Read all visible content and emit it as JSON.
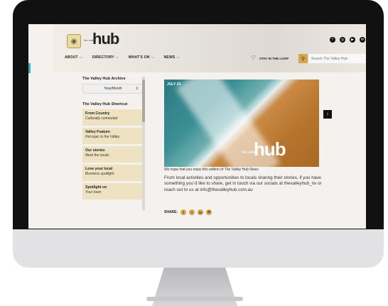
{
  "header": {
    "logo_small": "the valley",
    "logo_text": "hub",
    "social": [
      "f",
      "◎",
      "▶",
      "✉"
    ],
    "nav": [
      {
        "label": "ABOUT"
      },
      {
        "label": "DIRECTORY"
      },
      {
        "label": "WHAT'S ON"
      },
      {
        "label": "NEWS"
      }
    ],
    "stay_label": "STAY IN THE LOOP",
    "search_placeholder": "Search The Valley Hub"
  },
  "sidebar": {
    "archive_title": "The Valley Hub Archive",
    "archive_select": "Year/Month",
    "shortcut_title": "The Valley Hub Shortcut",
    "items": [
      {
        "title": "From Country",
        "subtitle": "Culturally connected"
      },
      {
        "title": "Valley Feature",
        "subtitle": "Hot topic in the Valley"
      },
      {
        "title": "Our stories",
        "subtitle": "Meet the locals"
      },
      {
        "title": "Love your local",
        "subtitle": "Business spotlight"
      },
      {
        "title": "Spotlight on",
        "subtitle": "Your town"
      }
    ]
  },
  "article": {
    "hero_date": "JULY 23",
    "hero_brand": "hub",
    "hero_brand_small": "the valley",
    "caption": "We hope that you enjoy this edition of The Valley Hub News.",
    "body": "From local activities and opportunities to locals sharing their stories, if you have something you`d like to share, get in touch via our socials at thevalleyhub_nv or reach out to us at info@thevalleyhub.com.au",
    "share_label": "SHARE:",
    "share_icons": [
      "f",
      "t",
      "in",
      "✉"
    ]
  },
  "colors": {
    "accent": "#d4a54a",
    "shortcut_bg": "#efe2c2",
    "teal": "#2fb3c7"
  }
}
